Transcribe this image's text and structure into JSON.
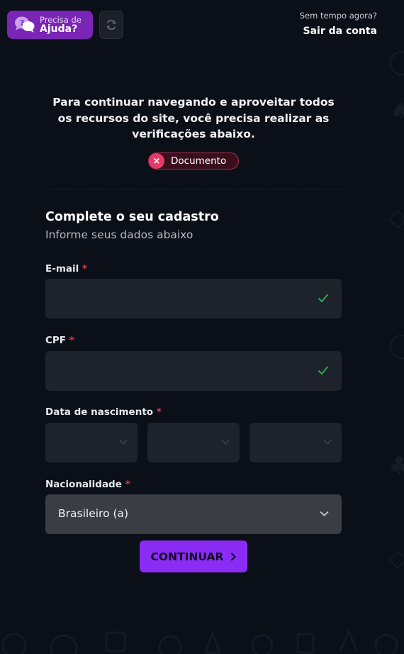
{
  "header": {
    "help_small": "Precisa de",
    "help_big": "Ajuda?",
    "no_time": "Sem tempo agora?",
    "logout": "Sair da conta"
  },
  "intro": {
    "message": "Para continuar navegando e aproveitar todos os recursos do site, você precisa realizar as verificações abaixo.",
    "badge_label": "Documento",
    "badge_icon": "×"
  },
  "form": {
    "title": "Complete o seu cadastro",
    "subtitle": "Informe seus dados abaixo",
    "required_mark": "*",
    "email_label": "E-mail",
    "cpf_label": "CPF",
    "birth_label": "Data de nascimento",
    "nationality_label": "Nacionalidade",
    "nationality_value": "Brasileiro (a)",
    "submit_label": "CONTINUAR"
  },
  "colors": {
    "background": "#0b0f18",
    "accent_purple": "#8b2cf5",
    "help_purple": "#7a25b5",
    "error_pink": "#e53a67",
    "valid_green": "#2fa84f",
    "required_red": "#e53a4a"
  },
  "icons": {
    "help": "chat-question-icon",
    "refresh": "refresh-icon",
    "valid": "check-icon",
    "dropdown": "chevron-down-icon",
    "next": "chevron-right-icon"
  }
}
